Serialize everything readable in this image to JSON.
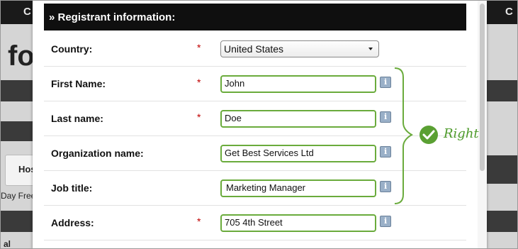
{
  "background": {
    "left_header": "C",
    "left_big": "fo",
    "left_tab": "Hos",
    "left_text": "Day Free",
    "left_bottom": "al",
    "right_header": "C"
  },
  "modal": {
    "section_title": "» Registrant information:",
    "fields": {
      "country": {
        "label": "Country:",
        "required": "*",
        "value": "United States"
      },
      "first_name": {
        "label": "First Name:",
        "required": "*",
        "value": "John",
        "info": "i"
      },
      "last_name": {
        "label": "Last name:",
        "required": "*",
        "value": "Doe",
        "info": "i"
      },
      "organization": {
        "label": "Organization name:",
        "value": "Get Best Services Ltd",
        "info": "i"
      },
      "job_title": {
        "label": "Job title:",
        "value": "Marketing Manager",
        "info": "i"
      },
      "address": {
        "label": "Address:",
        "required": "*",
        "value": "705 4th Street",
        "info": "i"
      }
    }
  },
  "annotation": {
    "label": "Right",
    "color": "#5aa033"
  },
  "colors": {
    "valid_border": "#6aab3c",
    "required_star": "#c00000",
    "header_bg": "#0f0f0f"
  }
}
